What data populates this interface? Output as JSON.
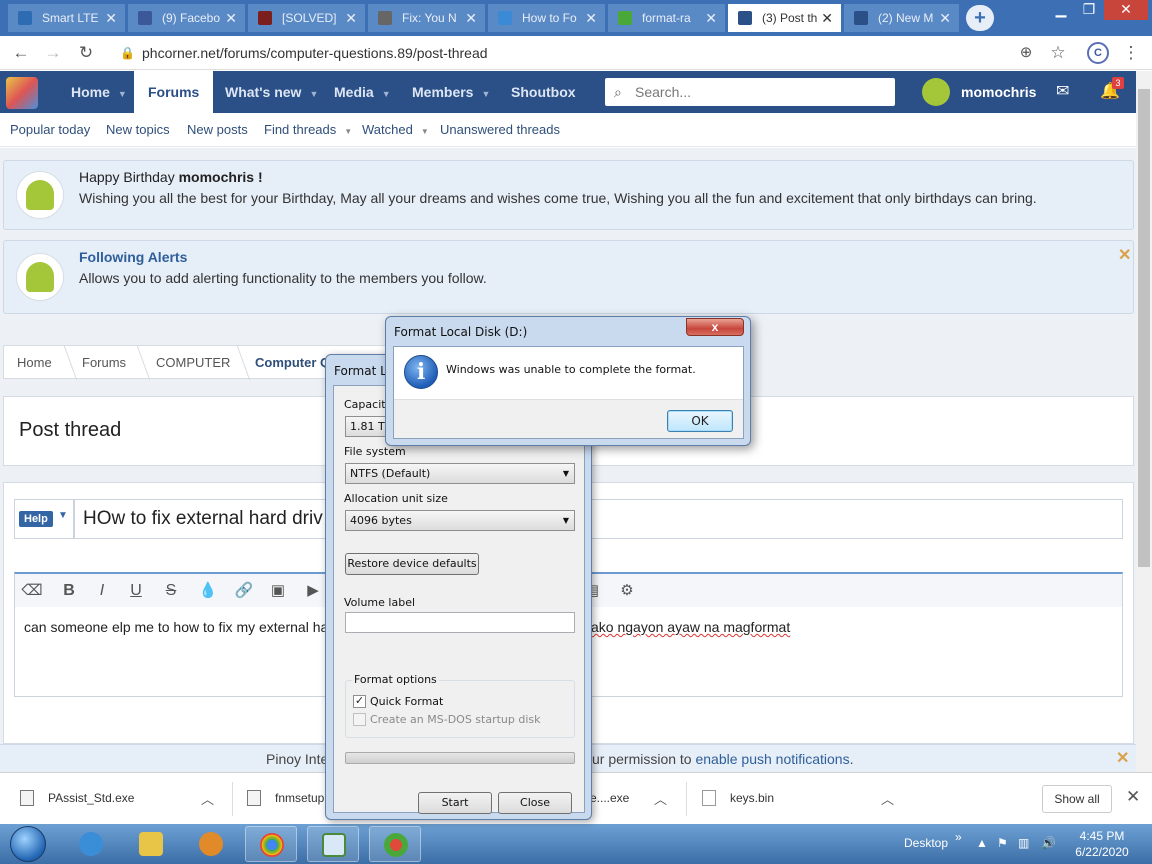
{
  "browser": {
    "tabs": [
      {
        "label": "Smart LTE",
        "icon": "square-icon",
        "color": "#2d6bb3"
      },
      {
        "label": "(9) Facebo",
        "icon": "facebook-icon",
        "color": "#3b5998"
      },
      {
        "label": "[SOLVED]",
        "icon": "mt-icon",
        "color": "#7a1e1e"
      },
      {
        "label": "Fix: You N",
        "icon": "gear-icon",
        "color": "#666666"
      },
      {
        "label": "How to Fo",
        "icon": "disk-icon",
        "color": "#3a8ad6"
      },
      {
        "label": "format-ra",
        "icon": "disk-icon",
        "color": "#4aa83a"
      },
      {
        "label": "(3) Post th",
        "icon": "phc-icon",
        "color": "#2b4f87"
      },
      {
        "label": "(2) New M",
        "icon": "phc-icon",
        "color": "#2b4f87"
      }
    ],
    "url": "phcorner.net/forums/computer-questions.89/post-thread",
    "profile_initial": "C"
  },
  "site": {
    "nav": [
      {
        "label": "Home"
      },
      {
        "label": "Forums"
      },
      {
        "label": "What's new"
      },
      {
        "label": "Media"
      },
      {
        "label": "Members"
      },
      {
        "label": "Shoutbox"
      }
    ],
    "search_placeholder": "Search...",
    "username": "momochris",
    "alerts_count": "3",
    "subnav": [
      "Popular today",
      "New topics",
      "New posts",
      "Find threads",
      "Watched",
      "Unanswered threads"
    ]
  },
  "notices": {
    "birthday_prefix": "Happy Birthday ",
    "birthday_user": "momochris !",
    "birthday_text": "Wishing you all the best for your Birthday, May all your dreams and wishes come true, Wishing you all the fun and excitement that only birthdays can bring.",
    "follow_title": "Following Alerts",
    "follow_text": "Allows you to add alerting functionality to the members you follow."
  },
  "breadcrumbs": [
    "Home",
    "Forums",
    "COMPUTER",
    "Computer Q"
  ],
  "post": {
    "heading": "Post thread",
    "prefix": "Help",
    "title_value": "HOw to fix external hard driv",
    "body_left": "can someone elp me to how to fix my external ha",
    "body_right": "ako ngayon ayaw na magformat"
  },
  "pushbar": {
    "left": "Pinoy Inte",
    "right_prefix": "ur permission to ",
    "right_link": "enable push notifications",
    "right_suffix": "."
  },
  "downloads": [
    {
      "name": "PAssist_Std.exe"
    },
    {
      "name": "fnmsetup"
    },
    {
      "name": "e....exe"
    },
    {
      "name": "keys.bin"
    }
  ],
  "show_all": "Show all",
  "format_dialog": {
    "title": "Format Local",
    "capacity_label": "Capacity",
    "capacity_value": "1.81 TB",
    "fs_label": "File system",
    "fs_value": "NTFS (Default)",
    "alloc_label": "Allocation unit size",
    "alloc_value": "4096 bytes",
    "restore_btn": "Restore device defaults",
    "volume_label": "Volume label",
    "options_label": "Format options",
    "quick_format": "Quick Format",
    "msdos_disk": "Create an MS-DOS startup disk",
    "start_btn": "Start",
    "close_btn": "Close"
  },
  "error_dialog": {
    "title": "Format Local Disk (D:)",
    "message": "Windows was unable to complete the format.",
    "ok": "OK",
    "close_glyph": "x"
  },
  "taskbar": {
    "desktop": "Desktop",
    "time": "4:45 PM",
    "date": "6/22/2020"
  }
}
